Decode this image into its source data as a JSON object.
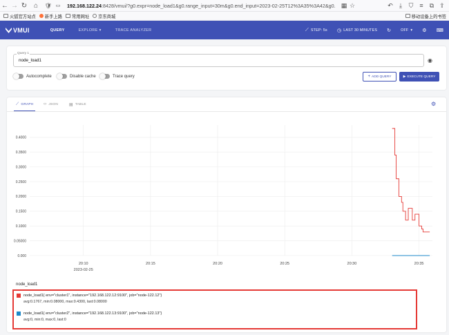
{
  "browser": {
    "url_host": "192.168.122.24",
    "url_rest": ":8428/vmui/?g0.expr=node_load1&g0.range_input=30m&g0.end_input=2023-02-25T12%3A35%3A42&g0.",
    "bookmarks": [
      "火狐官方站点",
      "新手上路",
      "常用网址",
      "京东商城"
    ],
    "bookmark_right": "移动设备上的书签"
  },
  "header": {
    "logo": "VMUI",
    "tabs": [
      {
        "label": "QUERY"
      },
      {
        "label": "EXPLORE"
      },
      {
        "label": "TRACE ANALYZER"
      }
    ],
    "step": "STEP: 5s",
    "time_range": "LAST 30 MINUTES",
    "refresh": "OFF"
  },
  "query": {
    "label": "Query 1",
    "value": "node_load1",
    "toggles": [
      {
        "label": "Autocomplete"
      },
      {
        "label": "Disable cache"
      },
      {
        "label": "Trace query"
      }
    ],
    "add_label": "ADD QUERY",
    "exec_label": "EXECUTE QUERY"
  },
  "graph": {
    "tabs": [
      {
        "label": "GRAPH"
      },
      {
        "label": "JSON"
      },
      {
        "label": "TABLE"
      }
    ]
  },
  "chart_data": {
    "type": "line",
    "y_ticks": [
      "0.000",
      "0.05000",
      "0.1000",
      "0.1500",
      "0.2000",
      "0.2500",
      "0.3000",
      "0.3500",
      "0.4000"
    ],
    "x_ticks": [
      "20:10",
      "20:15",
      "20:20",
      "20:25",
      "20:30",
      "20:35"
    ],
    "x_date": "2023-02-25",
    "ylim": [
      0,
      0.43
    ],
    "xlim": [
      "20:06",
      "20:36"
    ],
    "grid": true,
    "series": [
      {
        "color": "#e53935",
        "x": [
          "20:33.0",
          "20:33.2",
          "20:33.3",
          "20:33.5",
          "20:33.7",
          "20:33.8",
          "20:34.0",
          "20:34.2",
          "20:34.3",
          "20:34.5",
          "20:34.7",
          "20:34.8",
          "20:35.0",
          "20:35.2",
          "20:35.3",
          "20:35.5",
          "20:35.7",
          "20:35.8"
        ],
        "values": [
          0.43,
          0.34,
          0.26,
          0.2,
          0.18,
          0.15,
          0.12,
          0.16,
          0.16,
          0.12,
          0.14,
          0.14,
          0.1,
          0.09,
          0.08,
          0.08,
          0.08,
          0.08
        ]
      },
      {
        "color": "#1e88c8",
        "x": [
          "20:33.0",
          "20:35.8"
        ],
        "values": [
          0,
          0
        ]
      }
    ]
  },
  "legend": {
    "title": "node_load1",
    "items": [
      {
        "color": "#e53935",
        "label": "node_load1{ env=\"cluster1\", instance=\"192.168.122.12:9100\", job=\"node-122.12\"}",
        "stats": "avg:0.1767, min:0.08000, max:0.4300, last:0.08000"
      },
      {
        "color": "#1e88c8",
        "label": "node_load1{ env=\"cluster2\", instance=\"192.168.122.13:9100\", job=\"node-122.13\"}",
        "stats": "avg:0, min:0, max:0, last:0"
      }
    ]
  }
}
